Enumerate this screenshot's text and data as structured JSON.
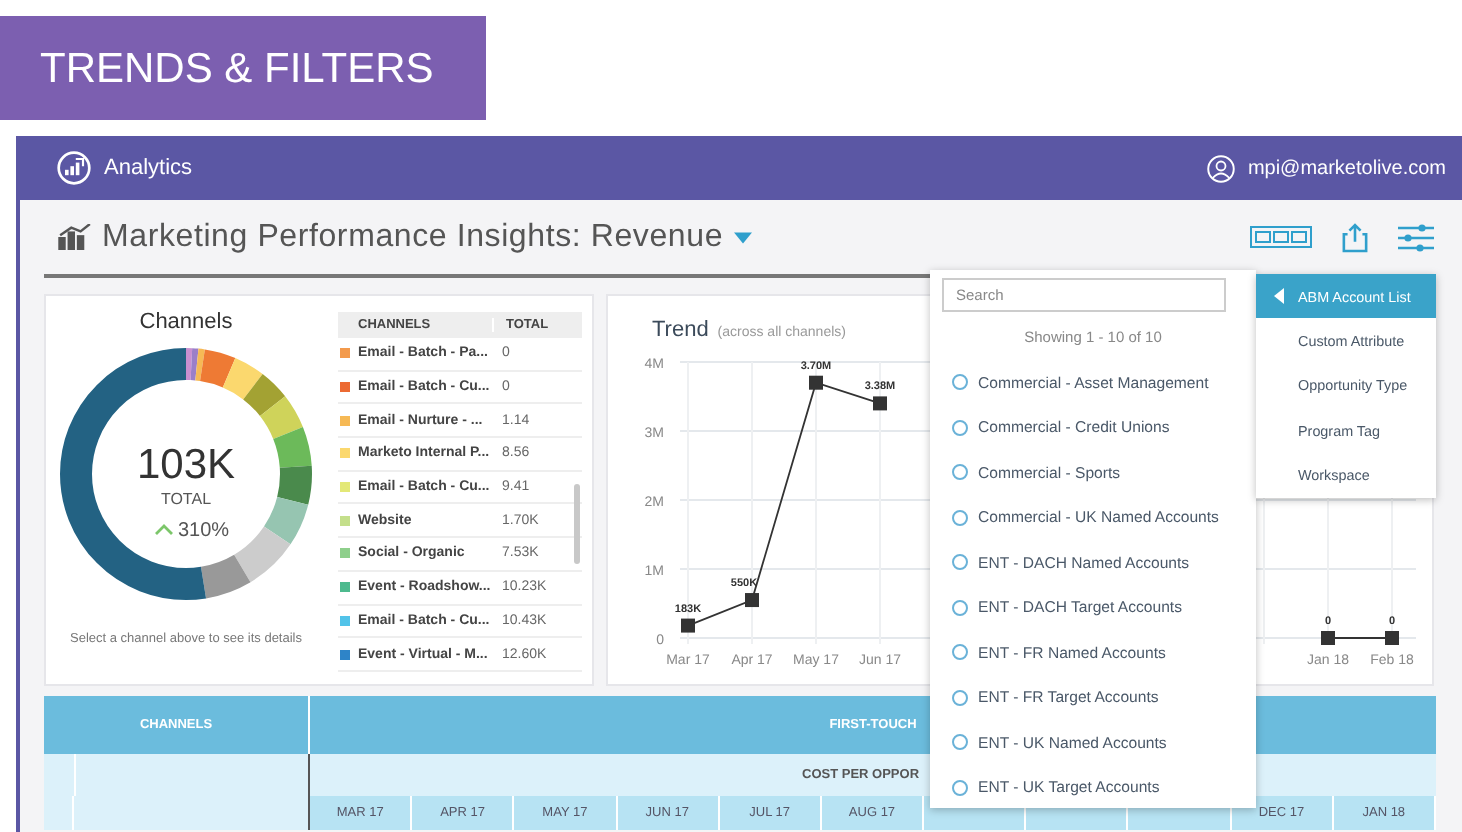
{
  "banner": {
    "title": "TRENDS & FILTERS"
  },
  "app_bar": {
    "title": "Analytics",
    "user": "mpi@marketolive.com"
  },
  "page": {
    "title": "Marketing Performance Insights:  Revenue"
  },
  "channels_card": {
    "title": "Channels",
    "total": "103K",
    "total_label": "TOTAL",
    "change": "310%",
    "caption": "Select a channel above to see its details",
    "columns": [
      "CHANNELS",
      "TOTAL"
    ],
    "rows": [
      {
        "name": "Email - Batch - Pa...",
        "total": "0",
        "color": "#f39a4c"
      },
      {
        "name": "Email - Batch - Cu...",
        "total": "0",
        "color": "#ec6a32"
      },
      {
        "name": "Email - Nurture - ...",
        "total": "1.14",
        "color": "#f6b955"
      },
      {
        "name": "Marketo Internal P...",
        "total": "8.56",
        "color": "#fbd86e"
      },
      {
        "name": "Email - Batch - Cu...",
        "total": "9.41",
        "color": "#e3e877"
      },
      {
        "name": "Website",
        "total": "1.70K",
        "color": "#c4df8b"
      },
      {
        "name": "Social - Organic",
        "total": "7.53K",
        "color": "#8ecf8b"
      },
      {
        "name": "Event - Roadshow...",
        "total": "10.23K",
        "color": "#4dba8e"
      },
      {
        "name": "Email - Batch - Cu...",
        "total": "10.43K",
        "color": "#52c3e9"
      },
      {
        "name": "Event - Virtual - M...",
        "total": "12.60K",
        "color": "#2e84c8"
      }
    ]
  },
  "trend_card": {
    "title": "Trend",
    "subtitle": "(across all channels)",
    "chart_data": {
      "type": "line",
      "categories": [
        "Mar 17",
        "Apr 17",
        "May 17",
        "Jun 17",
        null,
        null,
        null,
        null,
        null,
        null,
        "Jan 18",
        "Feb 18"
      ],
      "grid": true,
      "series": [
        {
          "color": "#333333",
          "marker": "square",
          "values": [
            180000,
            550000,
            3700000,
            3400000,
            null,
            null,
            null,
            null,
            null,
            null,
            0,
            0
          ]
        }
      ],
      "ylim": [
        0,
        4000000
      ],
      "yticks": [
        {
          "value": 0,
          "label": "0"
        },
        {
          "value": 1000000,
          "label": "1M"
        },
        {
          "value": 2000000,
          "label": "2M"
        },
        {
          "value": 3000000,
          "label": "3M"
        },
        {
          "value": 4000000,
          "label": "4M"
        }
      ],
      "value_labels": [
        "183K",
        "550K",
        "3.70M",
        "3.38M",
        null,
        null,
        null,
        null,
        null,
        null,
        "0",
        "0"
      ]
    }
  },
  "table": {
    "channels_header": "CHANNELS",
    "group_header": "FIRST-TOUCH",
    "metric_header": "COST PER OPPOR",
    "months_left": [
      "MAR 17",
      "APR 17",
      "MAY 17",
      "JUN 17",
      "JUL 17",
      "AUG 17"
    ],
    "months_right": [
      "DEC 17",
      "JAN 18"
    ]
  },
  "filter_dropdown": {
    "search_placeholder": "Search",
    "summary": "Showing 1 - 10 of 10",
    "options": [
      {
        "label": "Commercial - Asset Management",
        "selected": false
      },
      {
        "label": "Commercial - Credit Unions",
        "selected": false
      },
      {
        "label": "Commercial - Sports",
        "selected": false
      },
      {
        "label": "Commercial - UK Named Accounts",
        "selected": false
      },
      {
        "label": "ENT - DACH Named Accounts",
        "selected": false
      },
      {
        "label": "ENT - DACH Target Accounts",
        "selected": false
      },
      {
        "label": "ENT - FR Named Accounts",
        "selected": false
      },
      {
        "label": "ENT - FR Target Accounts",
        "selected": false
      },
      {
        "label": "ENT - UK Named Accounts",
        "selected": false
      },
      {
        "label": "ENT - UK Target Accounts",
        "selected": false
      }
    ]
  },
  "filter_menu": {
    "items": [
      {
        "label": "ABM Account List",
        "selected": true
      },
      {
        "label": "Custom Attribute",
        "selected": false
      },
      {
        "label": "Opportunity Type",
        "selected": false
      },
      {
        "label": "Program Tag",
        "selected": false
      },
      {
        "label": "Workspace",
        "selected": false
      }
    ]
  }
}
